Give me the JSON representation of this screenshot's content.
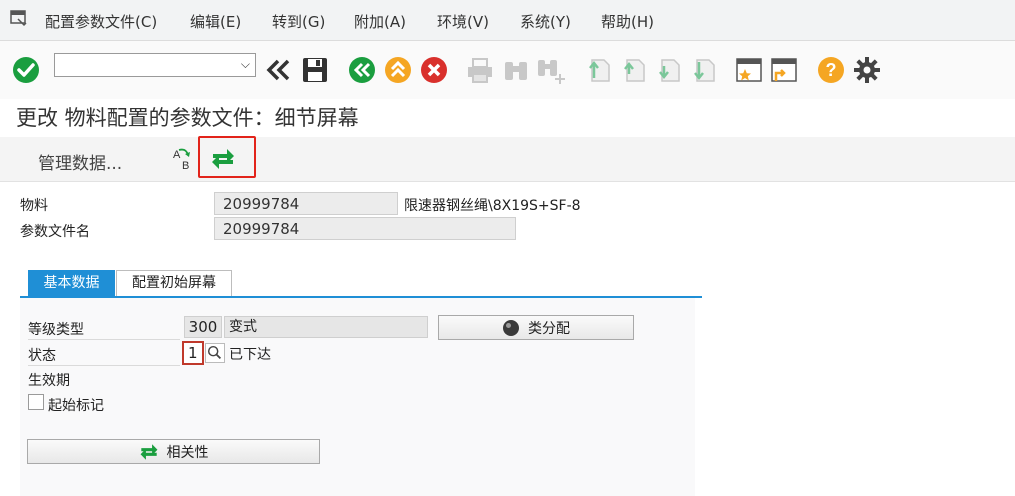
{
  "menu": [
    {
      "name": "menu-config-profile",
      "label": "配置参数文件(C)"
    },
    {
      "name": "menu-edit",
      "label": "编辑(E)"
    },
    {
      "name": "menu-goto",
      "label": "转到(G)"
    },
    {
      "name": "menu-extras",
      "label": "附加(A)"
    },
    {
      "name": "menu-environment",
      "label": "环境(V)"
    },
    {
      "name": "menu-system",
      "label": "系统(Y)"
    },
    {
      "name": "menu-help",
      "label": "帮助(H)"
    }
  ],
  "command": {
    "value": "",
    "placeholder": ""
  },
  "title": "更改 物料配置的参数文件：细节屏幕",
  "app_toolbar": {
    "manage_data": "管理数据..."
  },
  "header": {
    "material_label": "物料",
    "material_value": "20999784",
    "material_desc": "限速器钢丝绳\\8X19S+SF-8",
    "profile_label": "参数文件名",
    "profile_value": "20999784"
  },
  "tabs": [
    {
      "label": "基本数据",
      "active": true
    },
    {
      "label": "配置初始屏幕",
      "active": false
    }
  ],
  "basic": {
    "class_type_label": "等级类型",
    "class_type_code": "300",
    "class_type_name": "变式",
    "class_assign_label": "类分配",
    "status_label": "状态",
    "status_value": "1",
    "status_text": "已下达",
    "valid_from_label": "生效期",
    "start_flag_label": "起始标记",
    "dependency_label": "相关性"
  },
  "colors": {
    "accent": "#1f8fd6",
    "highlight": "#e2231a",
    "green": "#1a9e3f",
    "orange": "#f5a623",
    "red": "#d9302c"
  }
}
